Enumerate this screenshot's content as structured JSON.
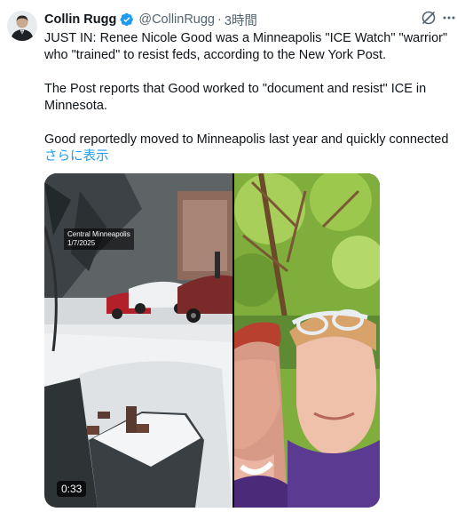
{
  "author": {
    "name": "Collin Rugg",
    "handle": "@CollinRugg",
    "separator": "·",
    "time": "3時間"
  },
  "body": {
    "paragraph1": "JUST IN: Renee Nicole Good was a Minneapolis \"ICE Watch\" \"warrior\" who \"trained\" to resist feds, according to the New York Post.",
    "paragraph2": "The Post reports that Good worked to \"document and resist\" ICE in Minnesota.",
    "paragraph3": "Good reportedly moved to Minneapolis last year and quickly connected",
    "show_more": "さらに表示"
  },
  "media": {
    "overlay_location": "Central Minneapolis",
    "overlay_date": "1/7/2025",
    "duration": "0:33"
  },
  "colors": {
    "link": "#1d9bf0",
    "verified": "#1d9bf0",
    "secondary_text": "#536471"
  },
  "icons": {
    "verified": "verified-badge-icon",
    "grok": "grok-icon",
    "more": "more-options-icon"
  }
}
